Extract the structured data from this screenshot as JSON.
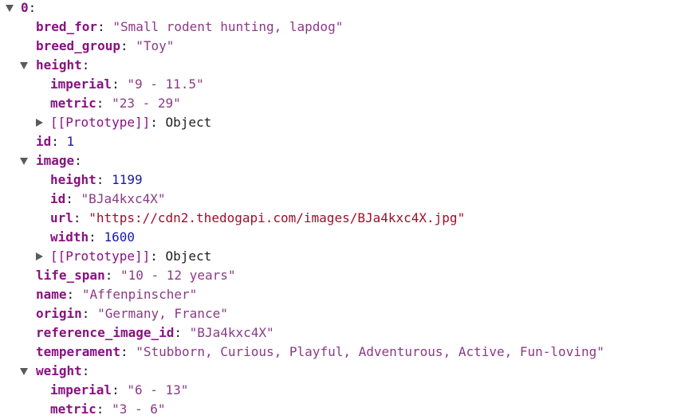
{
  "console": {
    "root_key": "0",
    "rows": [
      {
        "key": "bred_for",
        "value": "\"Small rodent hunting, lapdog\""
      },
      {
        "key": "breed_group",
        "value": "\"Toy\""
      },
      {
        "key": "height"
      },
      {
        "key": "imperial",
        "value": "\"9 - 11.5\""
      },
      {
        "key": "metric",
        "value": "\"23 - 29\""
      },
      {
        "key": "[[Prototype]]",
        "value": "Object"
      },
      {
        "key": "id",
        "value": "1"
      },
      {
        "key": "image"
      },
      {
        "key": "height",
        "value": "1199"
      },
      {
        "key": "id",
        "value": "\"BJa4kxc4X\""
      },
      {
        "key": "url",
        "value": "\"https://cdn2.thedogapi.com/images/BJa4kxc4X.jpg\""
      },
      {
        "key": "width",
        "value": "1600"
      },
      {
        "key": "[[Prototype]]",
        "value": "Object"
      },
      {
        "key": "life_span",
        "value": "\"10 - 12 years\""
      },
      {
        "key": "name",
        "value": "\"Affenpinscher\""
      },
      {
        "key": "origin",
        "value": "\"Germany, France\""
      },
      {
        "key": "reference_image_id",
        "value": "\"BJa4kxc4X\""
      },
      {
        "key": "temperament",
        "value": "\"Stubborn, Curious, Playful, Adventurous, Active, Fun-loving\""
      },
      {
        "key": "weight"
      },
      {
        "key": "imperial",
        "value": "\"6 - 13\""
      },
      {
        "key": "metric",
        "value": "\"3 - 6\""
      }
    ],
    "colon": ":"
  }
}
